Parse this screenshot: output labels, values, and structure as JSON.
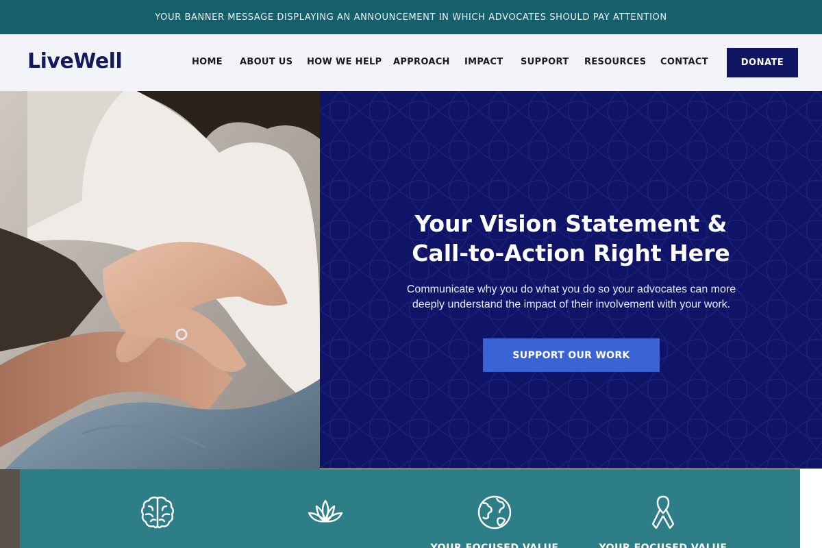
{
  "banner": {
    "text": "YOUR BANNER MESSAGE DISPLAYING AN ANNOUNCEMENT IN WHICH ADVOCATES SHOULD PAY ATTENTION"
  },
  "header": {
    "logo": "LiveWell",
    "nav": [
      "HOME",
      "ABOUT US",
      "HOW WE HELP",
      "APPROACH",
      "IMPACT",
      "SUPPORT",
      "RESOURCES",
      "CONTACT"
    ],
    "donate_label": "DONATE"
  },
  "hero": {
    "title_line1": "Your Vision Statement &",
    "title_line2": "Call-to-Action Right Here",
    "subtitle_line1": "Communicate why you do what you do so your advocates can more",
    "subtitle_line2": "deeply understand the impact of their involvement with your work.",
    "cta_label": "SUPPORT OUR WORK",
    "photo": {
      "subject": "couple holding hands",
      "icon": "photo-image"
    }
  },
  "values": {
    "items": [
      {
        "icon": "brain-icon",
        "label": ""
      },
      {
        "icon": "lotus-icon",
        "label": ""
      },
      {
        "icon": "globe-icon",
        "label": "YOUR FOCUSED VALUE"
      },
      {
        "icon": "ribbon-icon",
        "label": "YOUR FOCUSED VALUE"
      }
    ]
  },
  "colors": {
    "banner": "#16606d",
    "header_bg": "#f3f4f8",
    "navy": "#101467",
    "donate": "#0f1560",
    "cta": "#3a63d6",
    "values_bg": "#2e7e88"
  }
}
